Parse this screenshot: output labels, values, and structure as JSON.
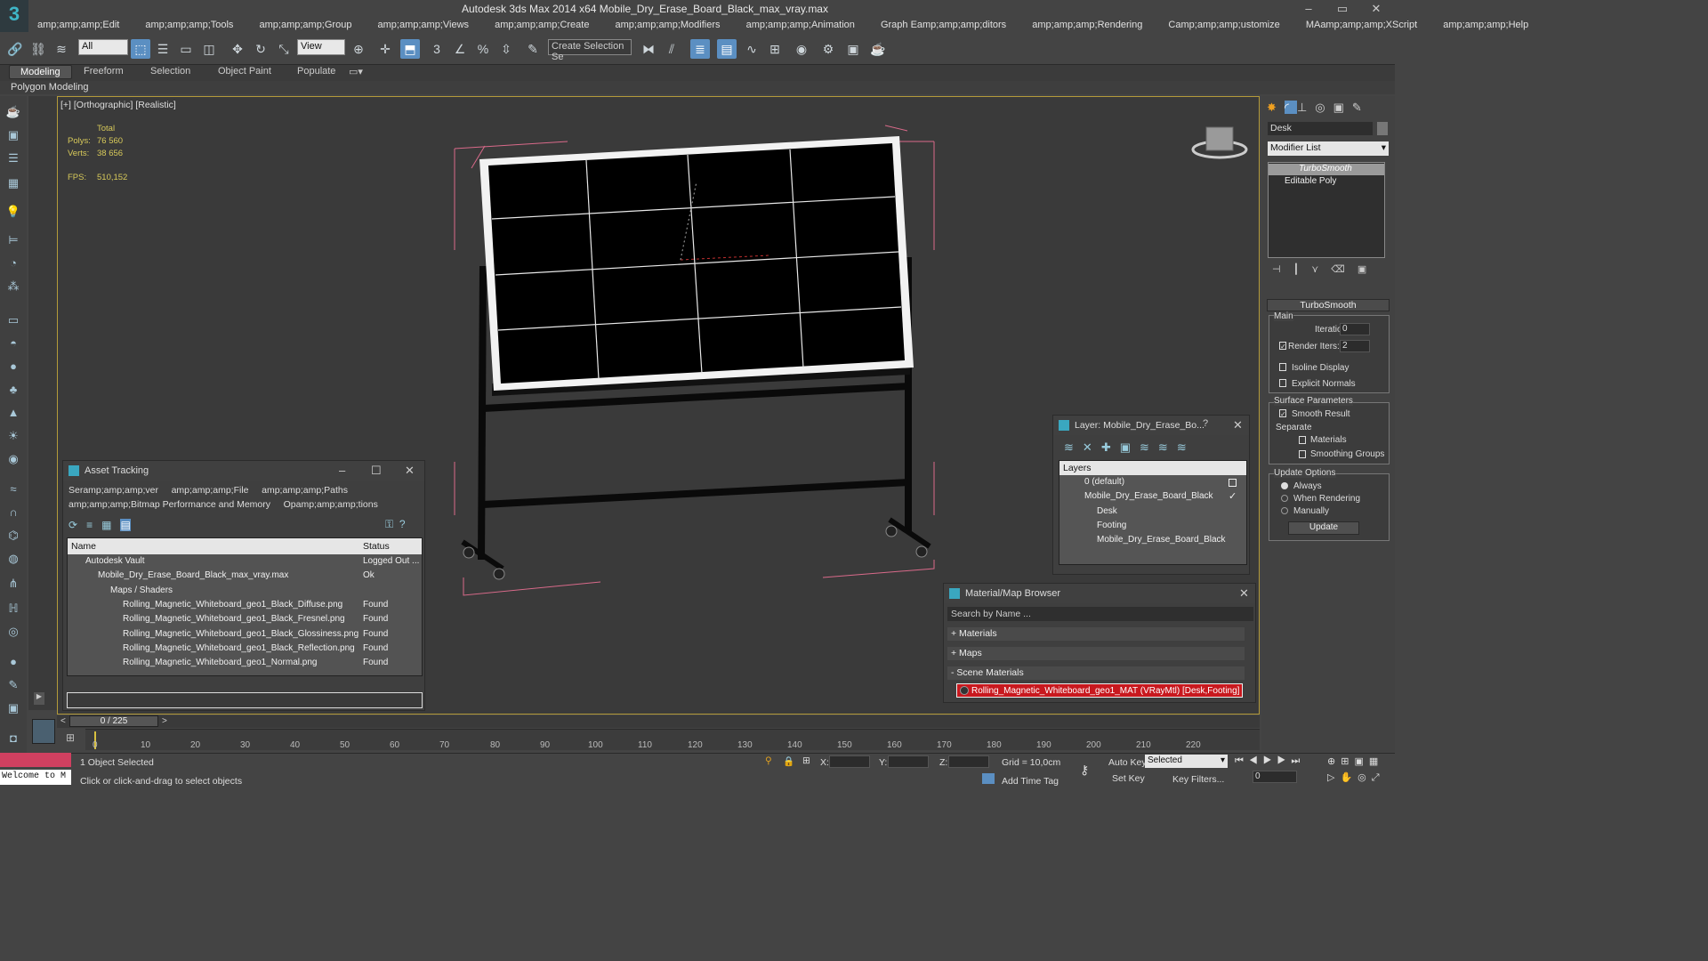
{
  "window": {
    "title": "Autodesk 3ds Max  2014 x64    Mobile_Dry_Erase_Board_Black_max_vray.max",
    "min": "–",
    "restore": "▭",
    "close": "✕"
  },
  "menu": [
    "amp;amp;amp;Edit",
    "amp;amp;amp;Tools",
    "amp;amp;amp;Group",
    "amp;amp;amp;Views",
    "amp;amp;amp;Create",
    "amp;amp;amp;Modifiers",
    "amp;amp;amp;Animation",
    "Graph Eamp;amp;amp;ditors",
    "amp;amp;amp;Rendering",
    "Camp;amp;amp;ustomize",
    "MAamp;amp;amp;XScript",
    "amp;amp;amp;Help"
  ],
  "toolbar": {
    "filter_value": "All",
    "refcoord_value": "View",
    "selection_set_placeholder": "Create Selection Se"
  },
  "ribbon": {
    "tabs": [
      "Modeling",
      "Freeform",
      "Selection",
      "Object Paint",
      "Populate"
    ],
    "subtab": "Polygon Modeling"
  },
  "viewport": {
    "label": "[+] [Orthographic] [Realistic]",
    "stats": {
      "total_label": "Total",
      "polys_label": "Polys:",
      "polys_value": "76 560",
      "verts_label": "Verts:",
      "verts_value": "38 656",
      "fps_label": "FPS:",
      "fps_value": "510,152"
    }
  },
  "asset_tracking": {
    "title": "Asset Tracking",
    "menu": [
      "Seramp;amp;amp;ver",
      "amp;amp;amp;File",
      "amp;amp;amp;Paths",
      "amp;amp;amp;Bitmap Performance and Memory",
      "Opamp;amp;amp;tions"
    ],
    "col_name": "Name",
    "col_status": "Status",
    "rows": [
      {
        "name": "Autodesk Vault",
        "status": "Logged Out ..."
      },
      {
        "name": "Mobile_Dry_Erase_Board_Black_max_vray.max",
        "status": "Ok"
      },
      {
        "name": "Maps / Shaders",
        "status": ""
      },
      {
        "name": "Rolling_Magnetic_Whiteboard_geo1_Black_Diffuse.png",
        "status": "Found"
      },
      {
        "name": "Rolling_Magnetic_Whiteboard_geo1_Black_Fresnel.png",
        "status": "Found"
      },
      {
        "name": "Rolling_Magnetic_Whiteboard_geo1_Black_Glossiness.png",
        "status": "Found"
      },
      {
        "name": "Rolling_Magnetic_Whiteboard_geo1_Black_Reflection.png",
        "status": "Found"
      },
      {
        "name": "Rolling_Magnetic_Whiteboard_geo1_Normal.png",
        "status": "Found"
      }
    ]
  },
  "layer_window": {
    "title": "Layer: Mobile_Dry_Erase_Bo...",
    "help": "?",
    "header": "Layers",
    "items": [
      "0 (default)",
      "Mobile_Dry_Erase_Board_Black",
      "Desk",
      "Footing",
      "Mobile_Dry_Erase_Board_Black"
    ]
  },
  "material_browser": {
    "title": "Material/Map Browser",
    "search_placeholder": "Search by Name ...",
    "sections": [
      "+ Materials",
      "+ Maps",
      "- Scene Materials"
    ],
    "scene_material": "Rolling_Magnetic_Whiteboard_geo1_MAT (VRayMtl) [Desk,Footing]"
  },
  "command_panel": {
    "object_name": "Desk",
    "modifier_list": "Modifier List",
    "stack": [
      "TurboSmooth",
      "Editable Poly"
    ],
    "rollout_title": "TurboSmooth",
    "main_label": "Main",
    "iterations_label": "Iterations:",
    "iterations_value": "0",
    "render_iters_label": "Render Iters:",
    "render_iters_value": "2",
    "isoline": "Isoline Display",
    "explicit": "Explicit Normals",
    "surface_label": "Surface Parameters",
    "smooth_result": "Smooth Result",
    "separate_label": "Separate",
    "materials": "Materials",
    "smoothing_groups": "Smoothing Groups",
    "update_options": "Update Options",
    "always": "Always",
    "when_rendering": "When Rendering",
    "manually": "Manually",
    "update_button": "Update"
  },
  "timeline": {
    "frame": "0 / 225",
    "ticks": [
      "0",
      "10",
      "20",
      "30",
      "40",
      "50",
      "60",
      "70",
      "80",
      "90",
      "100",
      "110",
      "120",
      "130",
      "140",
      "150",
      "160",
      "170",
      "180",
      "190",
      "200",
      "210",
      "220"
    ]
  },
  "status": {
    "welcome": "Welcome to M",
    "selected": "1 Object Selected",
    "prompt": "Click or click-and-drag to select objects",
    "x_label": "X:",
    "y_label": "Y:",
    "z_label": "Z:",
    "grid": "Grid = 10,0cm",
    "add_time_tag": "Add Time Tag",
    "auto_key": "Auto Key",
    "set_key": "Set Key",
    "selected_dropdown": "Selected",
    "key_filters": "Key Filters...",
    "frame_field": "0"
  }
}
